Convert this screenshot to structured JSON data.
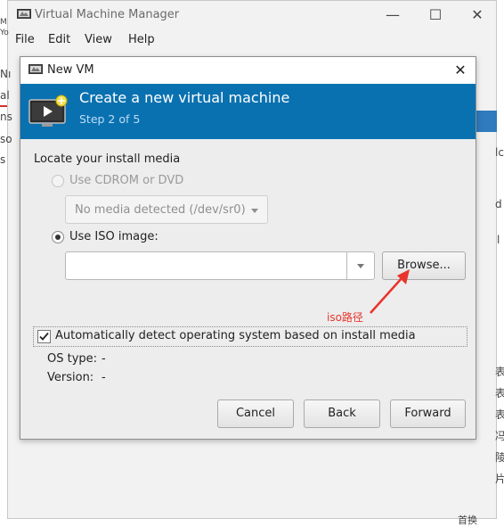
{
  "parent_window": {
    "title": "Virtual Machine Manager",
    "menu": [
      "File",
      "Edit",
      "View",
      "Help"
    ],
    "controls": {
      "minimize": "—",
      "maximize": "☐",
      "close": "✕"
    }
  },
  "edge_fragments": {
    "left": [
      "M",
      "Yo",
      "Nı",
      "al",
      "ns",
      "so",
      "s"
    ],
    "right": [
      "lc",
      "d",
      "l",
      "表",
      "表",
      "表",
      "冯",
      "陵",
      "片",
      "首换"
    ]
  },
  "dialog": {
    "title": "New VM",
    "close": "✕",
    "banner": {
      "title": "Create a new virtual machine",
      "step": "Step 2 of 5"
    },
    "section_label": "Locate your install media",
    "cdrom_option": {
      "label": "Use CDROM or DVD",
      "selected": false,
      "enabled": false
    },
    "cdrom_combo": {
      "value": "No media detected (/dev/sr0)"
    },
    "iso_option": {
      "label": "Use ISO image:",
      "selected": true
    },
    "iso_entry": {
      "value": "",
      "placeholder": ""
    },
    "browse_button": "Browse...",
    "annotation": "iso路径",
    "auto_detect": {
      "label": "Automatically detect operating system based on install media",
      "checked": true
    },
    "os_type": {
      "label": "OS type:",
      "value": "-"
    },
    "version": {
      "label": "Version:",
      "value": "-"
    },
    "buttons": {
      "cancel": "Cancel",
      "back": "Back",
      "forward": "Forward"
    }
  },
  "colors": {
    "banner": "#0a71b0",
    "annotation": "#e8342c"
  }
}
